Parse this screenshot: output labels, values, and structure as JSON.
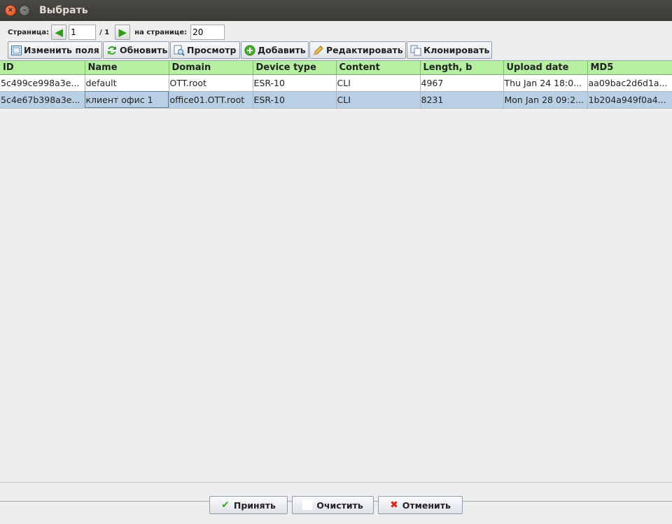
{
  "window": {
    "title": "Выбрать"
  },
  "pager": {
    "page_label": "Страница:",
    "page_value": "1",
    "total": "/ 1",
    "per_page_label": "на странице:",
    "per_page_value": "20"
  },
  "toolbar": {
    "edit_fields": "Изменить поля",
    "refresh": "Обновить",
    "view": "Просмотр",
    "add": "Добавить",
    "edit": "Редактировать",
    "clone": "Клонировать"
  },
  "table": {
    "headers": [
      "ID",
      "Name",
      "Domain",
      "Device type",
      "Content",
      "Length, b",
      "Upload date",
      "MD5"
    ],
    "rows": [
      [
        "5c499ce998a3e...",
        "default",
        "OTT.root",
        "ESR-10",
        "CLI",
        "4967",
        "Thu Jan 24 18:0...",
        "aa09bac2d6d1a..."
      ],
      [
        "5c4e67b398a3e...",
        "клиент офис 1",
        "office01.OTT.root",
        "ESR-10",
        "CLI",
        "8231",
        "Mon Jan 28 09:2...",
        "1b204a949f0a4..."
      ]
    ]
  },
  "footer": {
    "accept": "Принять",
    "clear": "Очистить",
    "cancel": "Отменить"
  },
  "colors": {
    "header_bg": "#b4f0a0",
    "selected_row": "#b8cfe5",
    "titlebar": "#3c3b37"
  }
}
